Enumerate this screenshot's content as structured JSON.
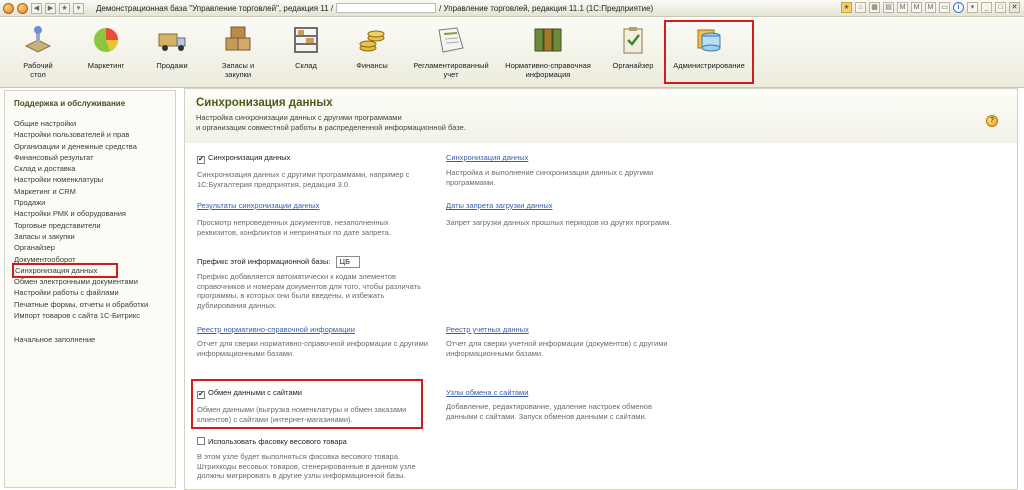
{
  "window": {
    "title_left": "Демонстрационная база \"Управление торговлей\", редакция 11 /",
    "title_right": "/ Управление торговлей, редакция 11.1  (1С:Предприятие)",
    "right_icons": [
      "star-icon",
      "home-icon",
      "calendar-icon",
      "m-icon",
      "m-plus-icon",
      "m-minus-icon",
      "window-icon",
      "info-icon",
      "minimize-icon",
      "close-icon"
    ]
  },
  "sections": [
    {
      "label1": "Рабочий",
      "label2": "стол"
    },
    {
      "label1": "Маркетинг",
      "label2": ""
    },
    {
      "label1": "Продажи",
      "label2": ""
    },
    {
      "label1": "Запасы и",
      "label2": "закупки"
    },
    {
      "label1": "Склад",
      "label2": ""
    },
    {
      "label1": "Финансы",
      "label2": ""
    },
    {
      "label1": "Регламентированный",
      "label2": "учет"
    },
    {
      "label1": "Нормативно-справочная",
      "label2": "информация"
    },
    {
      "label1": "Органайзер",
      "label2": ""
    },
    {
      "label1": "Администрирование",
      "label2": ""
    }
  ],
  "nav": {
    "header": "Поддержка и обслуживание",
    "items": [
      "Общие настройки",
      "Настройки пользователей и прав",
      "Организации и денежные средства",
      "Финансовый результат",
      "Склад и доставка",
      "Настройки номенклатуры",
      "Маркетинг и CRM",
      "Продажи",
      "Настройки РМК и оборудования",
      "Торговые представители",
      "Запасы и закупки",
      "Органайзер",
      "Документооборот",
      "Синхронизация данных",
      "Обмен электронными документами",
      "Настройки работы с файлами",
      "Печатные формы, отчеты и обработки",
      "Импорт товаров с сайта 1С-Битрикс"
    ],
    "bottom": "Начальное заполнение"
  },
  "main": {
    "title": "Синхронизация данных",
    "desc1": "Настройка синхронизации данных с другими программами",
    "desc2": "и организация совместной работы в распределенной информационной базе.",
    "help": "?",
    "sync_checkbox_label": "Синхронизация данных",
    "sync_text1": "Синхронизация данных с другими программами, например с",
    "sync_text2": "1С:Бухгалтерия предприятия, редакция 3.0.",
    "sync_link": "Синхронизация данных",
    "sync_link_text1": "Настройка и выполнение синхронизации данных с другими",
    "sync_link_text2": "программами.",
    "results_link": "Результаты синхронизации данных",
    "results_text1": "Просмотр непроведенных документов, незаполненных",
    "results_text2": "реквизитов, конфликтов и непринятых по дате запрета.",
    "dates_link": "Даты запрета загрузки данных",
    "dates_text1": "Запрет загрузки данных прошлых периодов из других программ.",
    "prefix_label": "Префикс этой информационной базы:",
    "prefix_value": "ЦБ",
    "prefix_text1": "Префикс добавляется автоматически к кодам элементов",
    "prefix_text2": "справочников и номерам документов для того, чтобы различать",
    "prefix_text3": "программы, в которых они были введены, и избежать",
    "prefix_text4": "дублирования данных.",
    "nsi_link": "Реестр нормативно-справочной информации",
    "nsi_text1": "Отчет для сверки нормативно-справочной информации с другими",
    "nsi_text2": "информационными базами.",
    "acc_link": "Реестр учетных данных",
    "acc_text1": "Отчет для сверки учетной информации (документов) с другими",
    "acc_text2": "информационными базами.",
    "sites_checkbox_label": "Обмен данными с сайтами",
    "sites_text1": "Обмен данными (выгрузка номенклатуры и обмен заказами",
    "sites_text2": "клиентов) с сайтами (интернет-магазинами).",
    "nodes_link": "Узлы обмена с сайтами",
    "nodes_text1": "Добавление, редактирование, удаление настроек обменов",
    "nodes_text2": "данными с сайтами. Запуск обменов данными с сайтами.",
    "weight_checkbox_label": "Использовать фасовку весового товара",
    "weight_text1": "В этом узле будет выполняться фасовка весового товара.",
    "weight_text2": "Штрихкоды весовых товаров, сгенерированные в данном узле",
    "weight_text3": "должны мигрировать в другие узлы информационной базы."
  }
}
